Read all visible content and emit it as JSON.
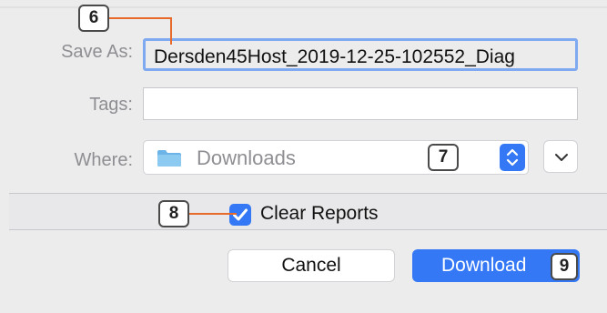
{
  "form": {
    "save_as_label": "Save As:",
    "save_as_value": "Dersden45Host_2019-12-25-102552_Diag",
    "tags_label": "Tags:",
    "tags_value": "",
    "where_label": "Where:",
    "where_value": "Downloads"
  },
  "options": {
    "clear_reports_label": "Clear Reports",
    "clear_reports_checked": true
  },
  "buttons": {
    "cancel_label": "Cancel",
    "download_label": "Download"
  },
  "annotations": {
    "badge_6": "6",
    "badge_7": "7",
    "badge_8": "8",
    "badge_9": "9"
  },
  "colors": {
    "accent": "#3478f6",
    "focus_ring": "#7fa9f0",
    "callout": "#e86a2a",
    "folder": "#6cb4e8"
  }
}
